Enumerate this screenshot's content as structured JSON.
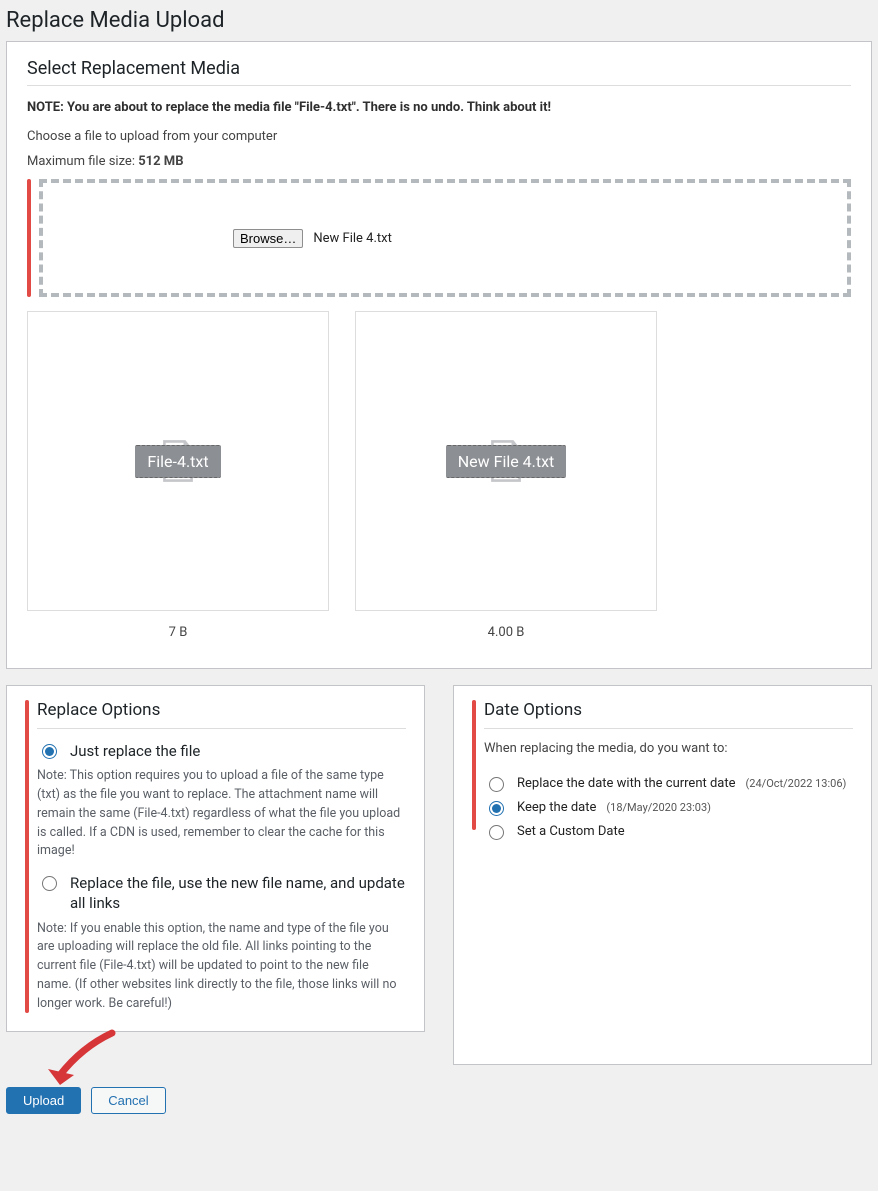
{
  "page": {
    "title": "Replace Media Upload"
  },
  "section": {
    "heading": "Select Replacement Media",
    "note": "NOTE: You are about to replace the media file \"File-4.txt\". There is no undo. Think about it!",
    "choose": "Choose a file to upload from your computer",
    "max_label": "Maximum file size: ",
    "max_value": "512 MB"
  },
  "upload": {
    "browse": "Browse…",
    "selected_file": "New File 4.txt"
  },
  "previews": {
    "old": {
      "name": "File-4.txt",
      "size": "7 B"
    },
    "new": {
      "name": "New File 4.txt",
      "size": "4.00 B"
    }
  },
  "replace": {
    "heading": "Replace Options",
    "opt1_label": "Just replace the file",
    "opt1_note": "Note: This option requires you to upload a file of the same type (txt) as the file you want to replace. The attachment name will remain the same (File-4.txt) regardless of what the file you upload is called. If a CDN is used, remember to clear the cache for this image!",
    "opt2_label": "Replace the file, use the new file name, and update all links",
    "opt2_note": "Note: If you enable this option, the name and type of the file you are uploading will replace the old file. All links pointing to the current file (File-4.txt) will be updated to point to the new file name. (If other websites link directly to the file, those links will no longer work. Be careful!)"
  },
  "date": {
    "heading": "Date Options",
    "desc": "When replacing the media, do you want to:",
    "opt1": "Replace the date with the current date",
    "opt1_sub": "(24/Oct/2022 13:06)",
    "opt2": "Keep the date",
    "opt2_sub": "(18/May/2020 23:03)",
    "opt3": "Set a Custom Date"
  },
  "buttons": {
    "upload": "Upload",
    "cancel": "Cancel"
  }
}
